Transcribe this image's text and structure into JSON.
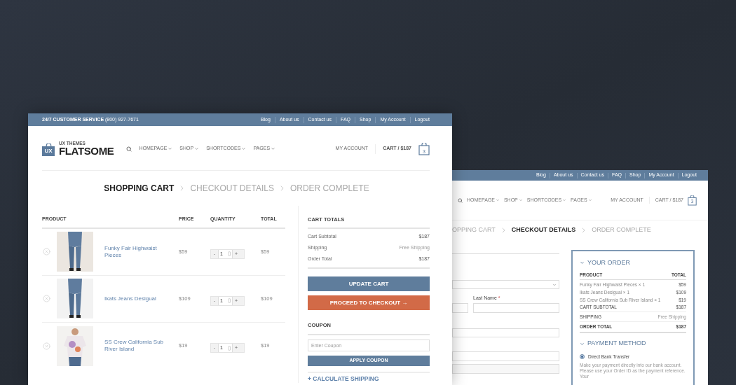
{
  "back_window": {
    "top_bar": {
      "links": [
        "Blog",
        "About us",
        "Contact us",
        "FAQ",
        "Shop",
        "My Account",
        "Logout"
      ]
    },
    "nav": {
      "menu": [
        "HOMEPAGE",
        "SHOP",
        "SHORTCODES",
        "PAGES"
      ],
      "account": "MY ACCOUNT",
      "cart": "CART / $187",
      "cart_count": "3"
    },
    "steps": [
      {
        "label": "OPPING CART",
        "selected": false
      },
      {
        "label": "CHECKOUT DETAILS",
        "selected": true
      },
      {
        "label": "ORDER COMPLETE",
        "selected": false
      }
    ],
    "form": {
      "last_name_label": "Last Name",
      "required_mark": "*"
    },
    "order": {
      "title": "YOUR ORDER",
      "columns": [
        "PRODUCT",
        "TOTAL"
      ],
      "items": [
        {
          "name": "Funky Fair Highwaist Pieces × 1",
          "total": "$59"
        },
        {
          "name": "Ikats Jeans Desigual × 1",
          "total": "$109"
        },
        {
          "name": "SS Crew California Sub River Island × 1",
          "total": "$19"
        }
      ],
      "summary": [
        {
          "kind": "subtotal",
          "label": "CART SUBTOTAL",
          "value": "$187"
        },
        {
          "kind": "shipping",
          "label": "SHIPPING",
          "value": "Free Shipping"
        },
        {
          "kind": "total",
          "label": "ORDER TOTAL",
          "value": "$187"
        }
      ],
      "payment_title": "PAYMENT METHOD",
      "payment_options": [
        {
          "label": "Direct Bank Transfer",
          "selected": true
        }
      ],
      "payment_note": "Make your payment directly into our bank account. Please use your Order ID as the payment reference. Your"
    }
  },
  "front_window": {
    "top_bar": {
      "service_label": "24/7 CUSTOMER SERVICE",
      "phone": "(800) 927-7671",
      "links": [
        "Blog",
        "About us",
        "Contact us",
        "FAQ",
        "Shop",
        "My Account",
        "Logout"
      ]
    },
    "logo": {
      "badge": "UX",
      "tagline": "UX THEMES",
      "name": "FLATSOME"
    },
    "nav": {
      "menu": [
        "HOMEPAGE",
        "SHOP",
        "SHORTCODES",
        "PAGES"
      ],
      "account": "MY ACCOUNT",
      "cart": "CART / $187",
      "cart_count": "3"
    },
    "steps": [
      {
        "label": "SHOPPING CART",
        "selected": true
      },
      {
        "label": "CHECKOUT DETAILS",
        "selected": false
      },
      {
        "label": "ORDER COMPLETE",
        "selected": false
      }
    ],
    "cart": {
      "columns": [
        "PRODUCT",
        "PRICE",
        "QUANTITY",
        "TOTAL"
      ],
      "rows": [
        {
          "product": "Funky Fair Highwaist Pieces",
          "price": "$59",
          "decrease": "-",
          "quantity": "1",
          "increase": "+",
          "total": "$59"
        },
        {
          "product": "Ikats Jeans Desigual",
          "price": "$109",
          "decrease": "-",
          "quantity": "1",
          "increase": "+",
          "total": "$109"
        },
        {
          "product": "SS Crew California Sub River Island",
          "price": "$19",
          "decrease": "-",
          "quantity": "1",
          "increase": "+",
          "total": "$19"
        }
      ]
    },
    "totals": {
      "title": "CART TOTALS",
      "rows": [
        {
          "kind": "subtotal",
          "label": "Cart Subtotal",
          "value": "$187"
        },
        {
          "kind": "shipping",
          "label": "Shipping",
          "value": "Free Shipping"
        },
        {
          "kind": "total",
          "label": "Order Total",
          "value": "$187"
        }
      ],
      "update_button": "UPDATE CART",
      "checkout_button": "PROCEED TO CHECKOUT →",
      "coupon_title": "COUPON",
      "coupon_placeholder": "Enter Coupon",
      "apply_button": "APPLY COUPON",
      "calculate_shipping": "+ CALCULATE SHIPPING"
    }
  }
}
